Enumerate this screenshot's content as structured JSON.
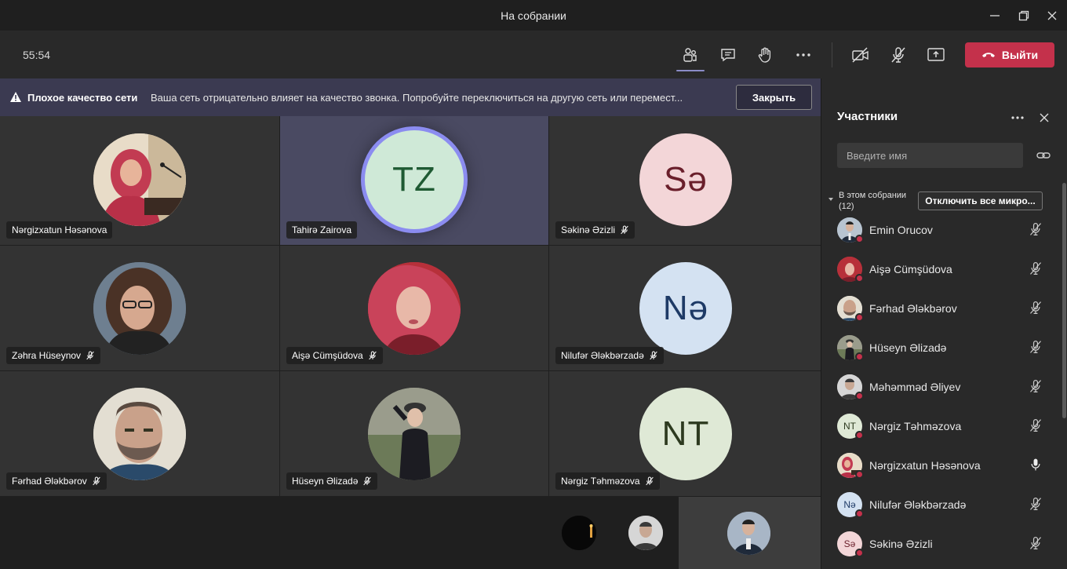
{
  "window": {
    "title": "На собрании"
  },
  "toolbar": {
    "timer": "55:54",
    "leave_label": "Выйти"
  },
  "banner": {
    "title": "Плохое качество сети",
    "message": "Ваша сеть отрицательно влияет на качество звонка. Попробуйте переключиться на другую сеть или перемест...",
    "close_label": "Закрыть"
  },
  "grid": [
    {
      "name": "Nərgizxatun Həsənova",
      "initials": "",
      "muted": false
    },
    {
      "name": "Tahirə Zairova",
      "initials": "TZ",
      "muted": false
    },
    {
      "name": "Səkinə Əzizli",
      "initials": "Sə",
      "muted": true
    },
    {
      "name": "Zəhra Hüseynov",
      "initials": "",
      "muted": true
    },
    {
      "name": "Aişə Cümşüdova",
      "initials": "",
      "muted": true
    },
    {
      "name": "Nilufər Ələkbərzadə",
      "initials": "Nə",
      "muted": true
    },
    {
      "name": "Fərhad Ələkbərov",
      "initials": "",
      "muted": true
    },
    {
      "name": "Hüseyn Əlizadə",
      "initials": "",
      "muted": true
    },
    {
      "name": "Nərgiz Təhməzova",
      "initials": "NT",
      "muted": true
    }
  ],
  "sidebar": {
    "title": "Участники",
    "search_placeholder": "Введите имя",
    "section_label": "В этом собрании",
    "section_count": "(12)",
    "mute_all_label": "Отключить все микро...",
    "participants": [
      {
        "name": "Emin Orucov",
        "initials": "",
        "mic": "muted"
      },
      {
        "name": "Aişə Cümşüdova",
        "initials": "",
        "mic": "muted"
      },
      {
        "name": "Fərhad Ələkbərov",
        "initials": "",
        "mic": "muted"
      },
      {
        "name": "Hüseyn Əlizadə",
        "initials": "",
        "mic": "muted"
      },
      {
        "name": "Məhəmməd Əliyev",
        "initials": "",
        "mic": "muted"
      },
      {
        "name": "Nərgiz Təhməzova",
        "initials": "NT",
        "mic": "muted"
      },
      {
        "name": "Nərgizxatun Həsənova",
        "initials": "",
        "mic": "on"
      },
      {
        "name": "Nilufər Ələkbərzadə",
        "initials": "Nə",
        "mic": "muted"
      },
      {
        "name": "Səkinə Əzizli",
        "initials": "Sə",
        "mic": "muted"
      }
    ]
  },
  "colors": {
    "leave": "#c4314b",
    "accent": "#8b8cc7",
    "banner": "#3b3a51"
  }
}
